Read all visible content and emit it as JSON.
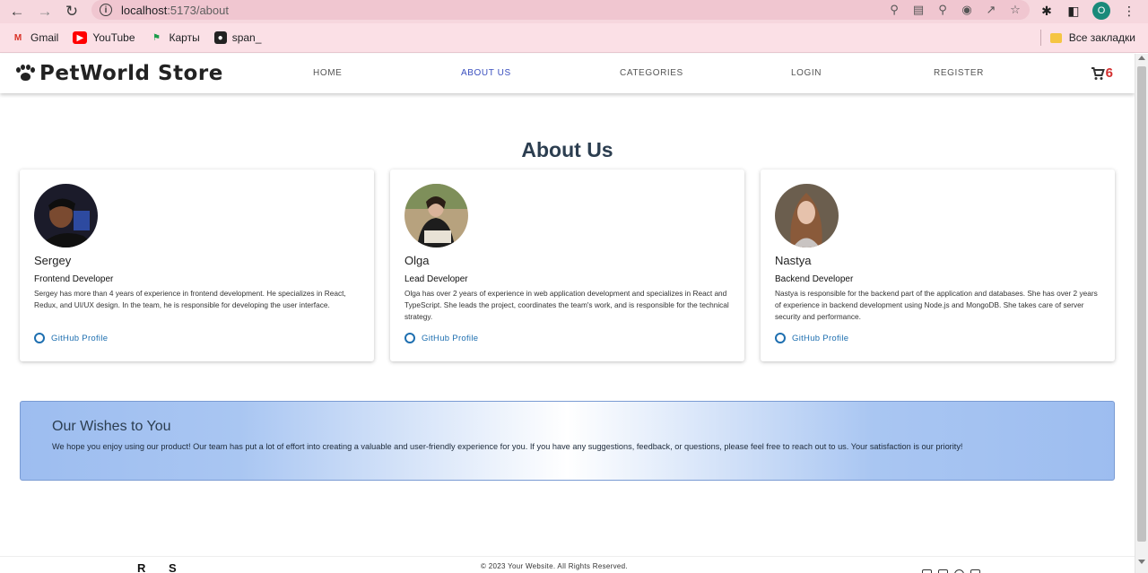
{
  "browser": {
    "url_host": "localhost",
    "url_path": ":5173/about",
    "profile_initial": "O",
    "bookmarks": [
      {
        "label": "Gmail",
        "icon": "gmail-icon"
      },
      {
        "label": "YouTube",
        "icon": "youtube-icon"
      },
      {
        "label": "Карты",
        "icon": "maps-icon"
      },
      {
        "label": "span_",
        "icon": "span-icon"
      }
    ],
    "all_bookmarks_label": "Все закладки"
  },
  "navbar": {
    "logo_text": "PetWorld Store",
    "links": [
      {
        "label": "HOME"
      },
      {
        "label": "ABOUT US"
      },
      {
        "label": "CATEGORIES"
      },
      {
        "label": "LOGIN"
      },
      {
        "label": "REGISTER"
      }
    ],
    "active_link": "ABOUT US",
    "cart_count": "6"
  },
  "main": {
    "title": "About Us",
    "team": [
      {
        "name": "Sergey",
        "role": "Frontend Developer",
        "description": "Sergey has more than 4 years of experience in frontend development. He specializes in React, Redux, and UI/UX design. In the team, he is responsible for developing the user interface.",
        "link_label": "GitHub Profile"
      },
      {
        "name": "Olga",
        "role": "Lead Developer",
        "description": "Olga has over 2 years of experience in web application development and specializes in React and TypeScript. She leads the project, coordinates the team's work, and is responsible for the technical strategy.",
        "link_label": "GitHub Profile"
      },
      {
        "name": "Nastya",
        "role": "Backend Developer",
        "description": "Nastya is responsible for the backend part of the application and databases. She has over 2 years of experience in backend development using Node.js and MongoDB. She takes care of server security and performance.",
        "link_label": "GitHub Profile"
      }
    ],
    "wishes": {
      "title": "Our Wishes to You",
      "text": "We hope you enjoy using our product! Our team has put a lot of effort into creating a valuable and user-friendly experience for you. If you have any suggestions, feedback, or questions, please feel free to reach out to us. Your satisfaction is our priority!"
    }
  },
  "footer": {
    "copyright": "© 2023 Your Website. All Rights Reserved.",
    "brand_r": "R",
    "brand_s": "S"
  },
  "colors": {
    "accent_active": "#3a4fbf",
    "cart_badge": "#d32f2f",
    "link": "#1e6fb0",
    "title": "#2c3e50"
  }
}
